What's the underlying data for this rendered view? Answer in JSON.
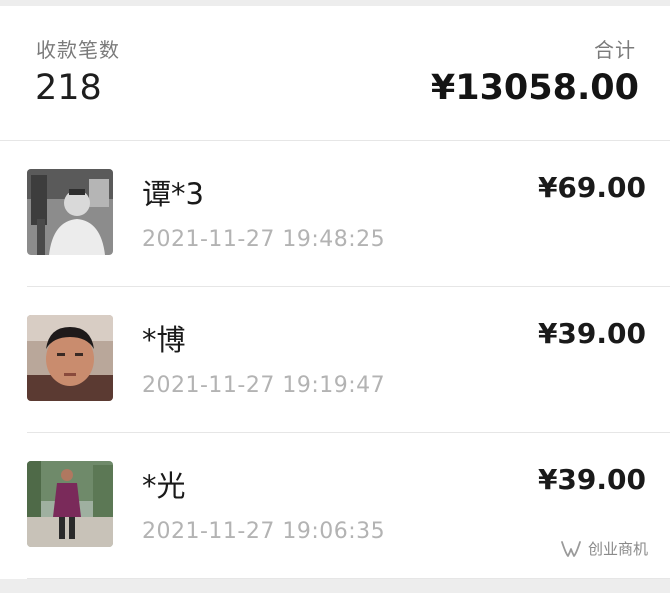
{
  "summary": {
    "count_label": "收款笔数",
    "count_value": "218",
    "total_label": "合计",
    "total_value": "¥13058.00"
  },
  "transactions": [
    {
      "name": "谭*3",
      "time": "2021-11-27 19:48:25",
      "amount": "¥69.00"
    },
    {
      "name": "*博",
      "time": "2021-11-27 19:19:47",
      "amount": "¥39.00"
    },
    {
      "name": "*光",
      "time": "2021-11-27 19:06:35",
      "amount": "¥39.00"
    }
  ],
  "watermark": {
    "text": "创业商机",
    "icon": "wechat-channel-icon"
  },
  "colors": {
    "primary_text": "#1a1a1a",
    "secondary_text": "#b3b3b3",
    "label_text": "#7b7b7b"
  }
}
